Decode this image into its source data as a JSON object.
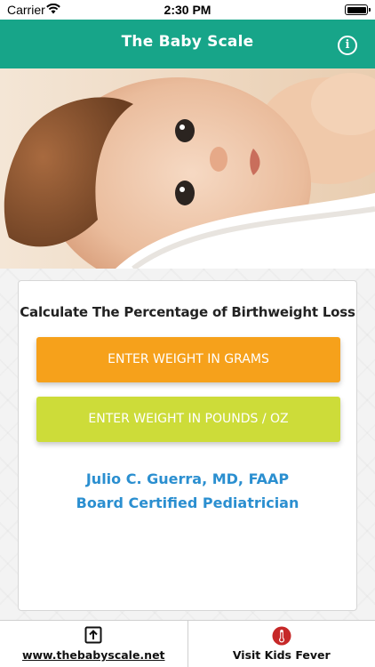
{
  "status_bar": {
    "carrier": "Carrier",
    "time": "2:30 PM"
  },
  "nav": {
    "title": "The Baby Scale",
    "info_icon": "info-icon"
  },
  "hero": {
    "image_icon": "baby-photo"
  },
  "card": {
    "heading": "Calculate The Percentage of Birthweight Loss",
    "grams_button": "ENTER WEIGHT IN GRAMS",
    "pounds_button": "ENTER WEIGHT IN POUNDS / OZ",
    "credit_name": "Julio C. Guerra, MD, FAAP",
    "credit_title": "Board Certified Pediatrician"
  },
  "colors": {
    "nav_bg": "#17a589",
    "grams_button": "#f6a11b",
    "pounds_button": "#cddc39",
    "credit_text": "#2b8fd0"
  },
  "bottom_bar": {
    "website_label": "www.thebabyscale.net",
    "website_icon": "share-icon",
    "kids_fever_label": "Visit Kids Fever",
    "kids_fever_icon": "thermometer-icon"
  }
}
